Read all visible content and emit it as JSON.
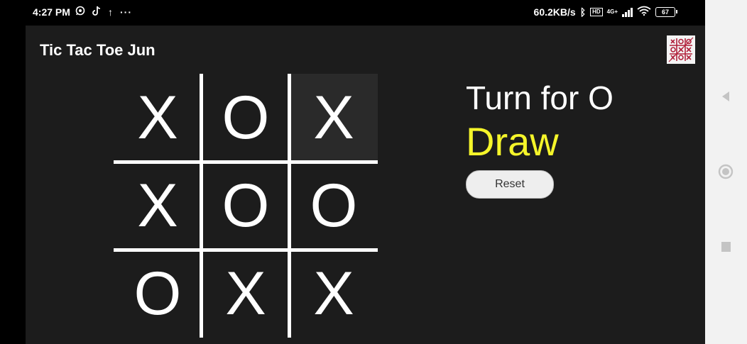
{
  "status_bar": {
    "time": "4:27 PM",
    "network_speed": "60.2KB/s",
    "volte_badge": "HD",
    "net_type": "4G+",
    "battery_level": "67",
    "left_icons": [
      "whatsapp-icon",
      "tiktok-icon",
      "upload-icon",
      "more-icon"
    ],
    "more_glyph": "···",
    "upload_glyph": "↑",
    "bluetooth_glyph": "ᛒ"
  },
  "app": {
    "title": "Tic Tac Toe Jun"
  },
  "board": {
    "cells": [
      "X",
      "O",
      "X",
      "X",
      "O",
      "O",
      "O",
      "X",
      "X"
    ],
    "highlighted_cell": 2
  },
  "status": {
    "turn_label": "Turn for O",
    "result": "Draw"
  },
  "controls": {
    "reset_label": "Reset"
  },
  "colors": {
    "app_background": "#1c1c1c",
    "result_text": "#f5f52a",
    "piece": "#ffffff",
    "grid_line": "#ffffff"
  }
}
